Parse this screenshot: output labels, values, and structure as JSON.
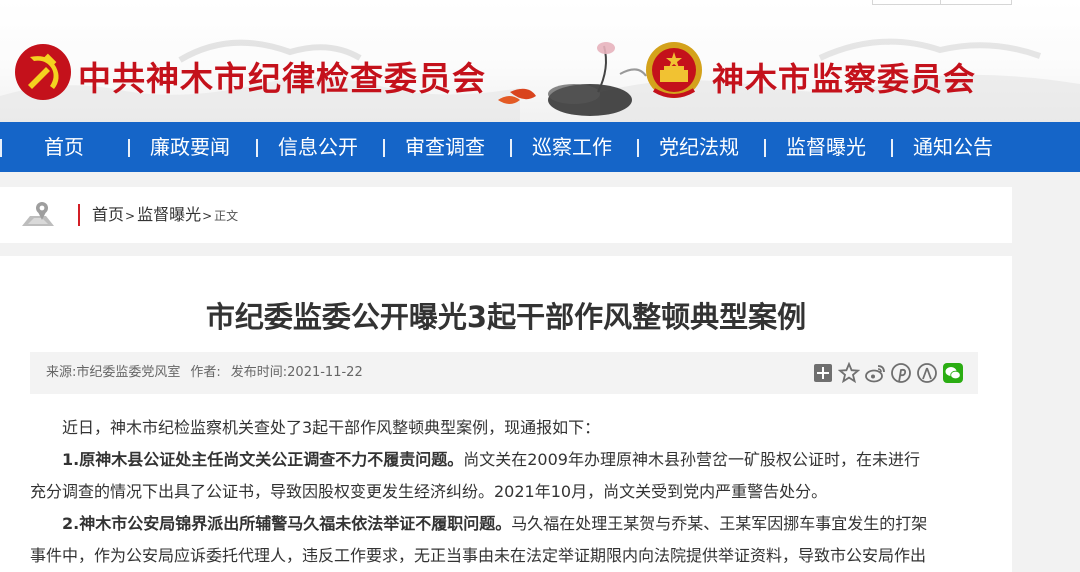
{
  "header": {
    "party_committee": "中共神木市纪律检查委员会",
    "supervision_committee": "神木市监察委员会"
  },
  "nav": {
    "items": [
      {
        "label": "首页"
      },
      {
        "label": "廉政要闻"
      },
      {
        "label": "信息公开"
      },
      {
        "label": "审查调查"
      },
      {
        "label": "巡察工作"
      },
      {
        "label": "党纪法规"
      },
      {
        "label": "监督曝光"
      },
      {
        "label": "通知公告"
      }
    ]
  },
  "breadcrumb": {
    "home": "首页",
    "section": "监督曝光",
    "current": "正文",
    "separator": ">"
  },
  "article": {
    "title": "市纪委监委公开曝光3起干部作风整顿典型案例",
    "source": "来源:市纪委监委党风室",
    "author": "作者:",
    "published": "发布时间:2021-11-22",
    "share_icons": [
      "plus-icon",
      "star-icon",
      "weibo-icon",
      "pinterest-icon",
      "renren-icon",
      "wechat-icon"
    ],
    "intro": "近日，神木市纪检监察机关查处了3起干部作风整顿典型案例，现通报如下：",
    "case1_heading": "1.原神木县公证处主任尚文关公正调查不力不履责问题。",
    "case1_line1": "尚文关在2009年办理原神木县孙营岔一矿股权公证时，在未进行",
    "case1_line2": "充分调查的情况下出具了公证书，导致因股权变更发生经济纠纷。2021年10月，尚文关受到党内严重警告处分。",
    "case2_heading": "2.神木市公安局锦界派出所辅警马久福未依法举证不履职问题。",
    "case2_line1": "马久福在处理王某贺与乔某、王某军因挪车事宜发生的打架",
    "case2_line2": "事件中，作为公安局应诉委托代理人，违反工作要求，无正当事由未在法定举证期限内向法院提供举证资料，导致市公安局作出"
  },
  "colors": {
    "brand_red": "#c4111b",
    "nav_blue": "#1565c8",
    "crumb_accent": "#d31f26",
    "wechat_green": "#2bad13"
  }
}
